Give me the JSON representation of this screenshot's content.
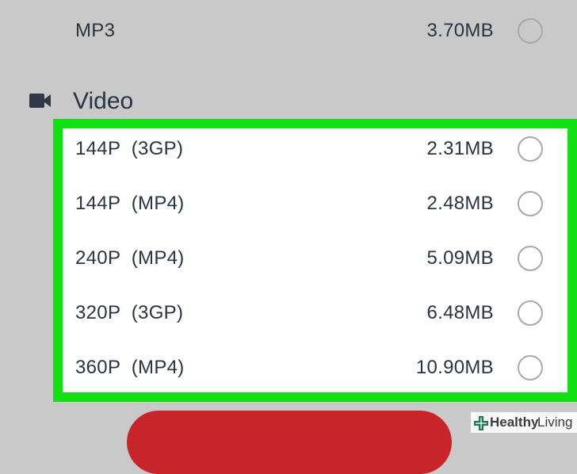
{
  "audio": {
    "rows": [
      {
        "format": "MP3",
        "size": "3.70MB"
      }
    ]
  },
  "video": {
    "title": "Video",
    "icon": "video-camera-icon",
    "rows": [
      {
        "format": "144P  (3GP)",
        "size": "2.31MB"
      },
      {
        "format": "144P  (MP4)",
        "size": "2.48MB"
      },
      {
        "format": "240P  (MP4)",
        "size": "5.09MB"
      },
      {
        "format": "320P  (3GP)",
        "size": "6.48MB"
      },
      {
        "format": "360P  (MP4)",
        "size": "10.90MB"
      }
    ]
  },
  "colors": {
    "background": "#c9c9c9",
    "highlight_border": "#12e012",
    "download_button": "#c8252a",
    "text": "#2a3441"
  },
  "watermark": {
    "part1": "Healthy",
    "part2": "Living"
  }
}
